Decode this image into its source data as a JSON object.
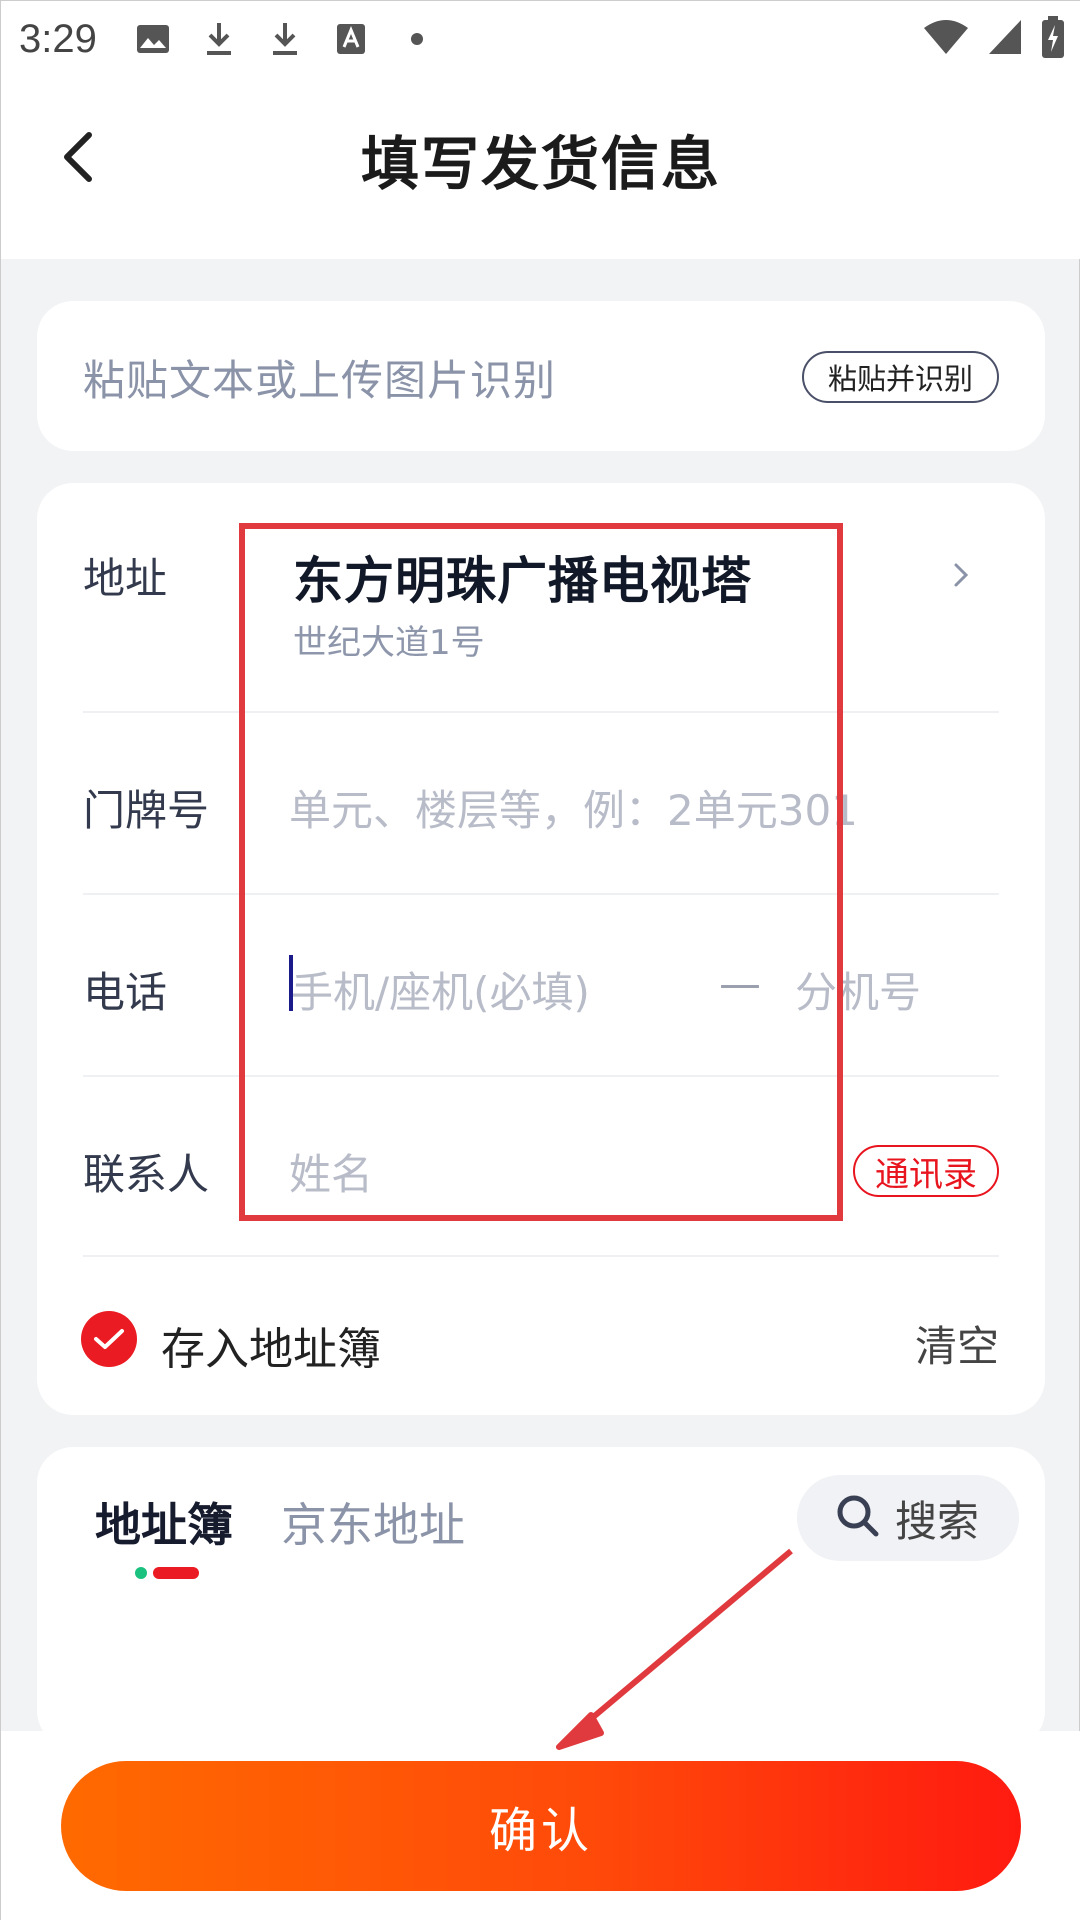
{
  "status_bar": {
    "time": "3:29",
    "icons": [
      "image-icon",
      "download-icon",
      "download-icon",
      "font-icon",
      "dot-icon"
    ],
    "right_icons": [
      "wifi-icon",
      "signal-icon",
      "battery-charging-icon"
    ]
  },
  "header": {
    "title": "填写发货信息",
    "back_icon": "chevron-left-icon"
  },
  "paste": {
    "hint": "粘贴文本或上传图片识别",
    "button_label": "粘贴并识别"
  },
  "form": {
    "address_label": "地址",
    "address_main": "东方明珠广播电视塔",
    "address_sub": "世纪大道1号",
    "unit_label": "门牌号",
    "unit_placeholder": "单元、楼层等，例：2单元301",
    "phone_label": "电话",
    "phone_placeholder": "手机/座机(必填)",
    "phone_separator": "—",
    "extension_placeholder": "分机号",
    "contact_label": "联系人",
    "contact_placeholder": "姓名",
    "contacts_button": "通讯录",
    "save_to_book_label": "存入地址簿",
    "save_to_book_checked": true,
    "clear_label": "清空"
  },
  "address_book": {
    "tabs": [
      {
        "label": "地址簿",
        "active": true
      },
      {
        "label": "京东地址",
        "active": false
      }
    ],
    "search_label": "搜索"
  },
  "confirm_button": "确认",
  "colors": {
    "accent_red": "#ea1b22",
    "confirm_gradient_start": "#ff6a00",
    "confirm_gradient_end": "#ff1a10",
    "annotation_red": "#e03a3e"
  }
}
